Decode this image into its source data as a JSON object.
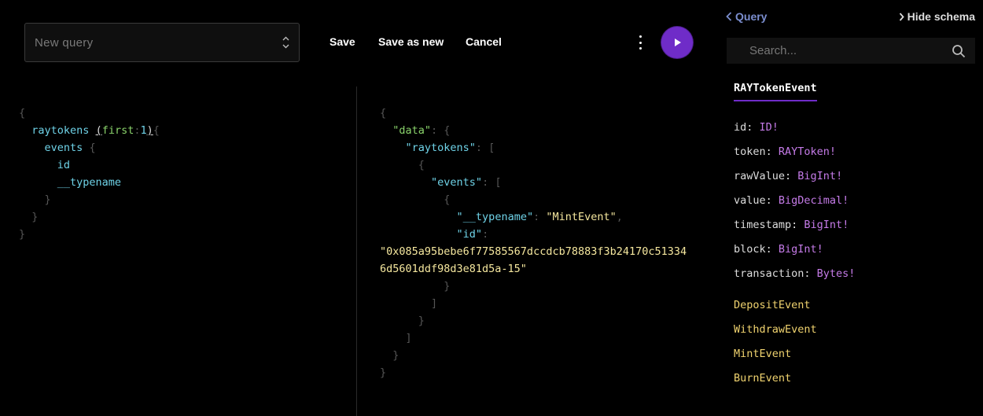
{
  "toolbar": {
    "query_placeholder": "New query",
    "save_label": "Save",
    "save_as_new_label": "Save as new",
    "cancel_label": "Cancel"
  },
  "editor": {
    "root_field": "raytokens",
    "arg_name": "first",
    "arg_value": "1",
    "sub_field": "events",
    "leaf_fields": [
      "id",
      "__typename"
    ]
  },
  "result": {
    "key_data": "\"data\"",
    "key_raytokens": "\"raytokens\"",
    "key_events": "\"events\"",
    "key_typename": "\"__typename\"",
    "val_typename": "\"MintEvent\"",
    "key_id": "\"id\"",
    "val_id_line1": "\"0x085a95bebe6f77585567dccdcb78883f3b24170c51334",
    "val_id_line2": "6d5601ddf98d3e81d5a-15\""
  },
  "schema": {
    "back_label": "Query",
    "hide_label": "Hide schema",
    "search_placeholder": "Search...",
    "type_name": "RAYTokenEvent",
    "fields": [
      {
        "name": "id",
        "type": "ID!"
      },
      {
        "name": "token",
        "type": "RAYToken!"
      },
      {
        "name": "rawValue",
        "type": "BigInt!"
      },
      {
        "name": "value",
        "type": "BigDecimal!"
      },
      {
        "name": "timestamp",
        "type": "BigInt!"
      },
      {
        "name": "block",
        "type": "BigInt!"
      },
      {
        "name": "transaction",
        "type": "Bytes!"
      }
    ],
    "implementations": [
      "DepositEvent",
      "WithdrawEvent",
      "MintEvent",
      "BurnEvent"
    ]
  },
  "colors": {
    "accent": "#6f2cc8",
    "field": "#6fd3e8",
    "string": "#f5e79e",
    "type": "#c57be8",
    "implementation": "#f0d36f"
  }
}
